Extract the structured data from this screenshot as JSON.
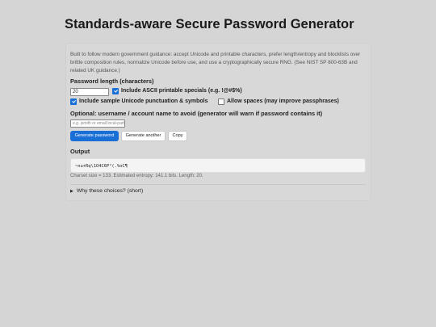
{
  "page": {
    "title": "Standards-aware Secure Password Generator"
  },
  "intro": "Built to follow modern government guidance: accept Unicode and printable characters, prefer length/entropy and blocklists over brittle composition rules, normalize Unicode before use, and use a cryptographically secure RNG. (See NIST SP 800-63B and related UK guidance.)",
  "length": {
    "label": "Password length (characters)",
    "value": "20"
  },
  "options": {
    "ascii_specials": {
      "label": "Include ASCII printable specials (e.g. !@#$%)",
      "checked": true
    },
    "unicode_punct": {
      "label": "Include sample Unicode punctuation & symbols",
      "checked": true
    },
    "spaces": {
      "label": "Allow spaces (may improve passphrases)",
      "checked": false
    }
  },
  "username": {
    "label": "Optional: username / account name to avoid (generator will warn if password contains it)",
    "placeholder": "e.g. jsmith or email local-part",
    "value": ""
  },
  "buttons": {
    "generate": "Generate password",
    "another": "Generate another",
    "copy": "Copy"
  },
  "output": {
    "label": "Output",
    "password": "~nu+Rq\\1O4C6P²(.%oC¶",
    "meta": "Charset size = 133. Estimated entropy: 141.1 bits. Length: 20."
  },
  "details": {
    "summary": "Why these choices? (short)",
    "expanded": false
  },
  "colors": {
    "accent": "#1a6fd6",
    "background": "#d5d5d5"
  }
}
